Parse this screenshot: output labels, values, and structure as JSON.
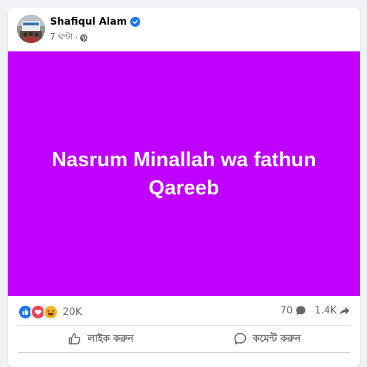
{
  "post": {
    "author": "Shafiqul Alam",
    "time": "7 ঘণ্টা",
    "separator": "·",
    "text": "Nasrum Minallah wa fathun Qareeb",
    "background_color": "#c000ff"
  },
  "stats": {
    "reaction_count": "20K",
    "comment_count": "70",
    "share_count": "1.4K",
    "reactions": [
      "like-icon",
      "love-icon",
      "haha-icon"
    ]
  },
  "actions": {
    "like_label": "লাইক করুন",
    "comment_label": "কমেন্ট করুন"
  },
  "colors": {
    "like": "#1877f2",
    "love": "#f33e58",
    "haha": "#f7b125",
    "muted": "#65676b"
  }
}
